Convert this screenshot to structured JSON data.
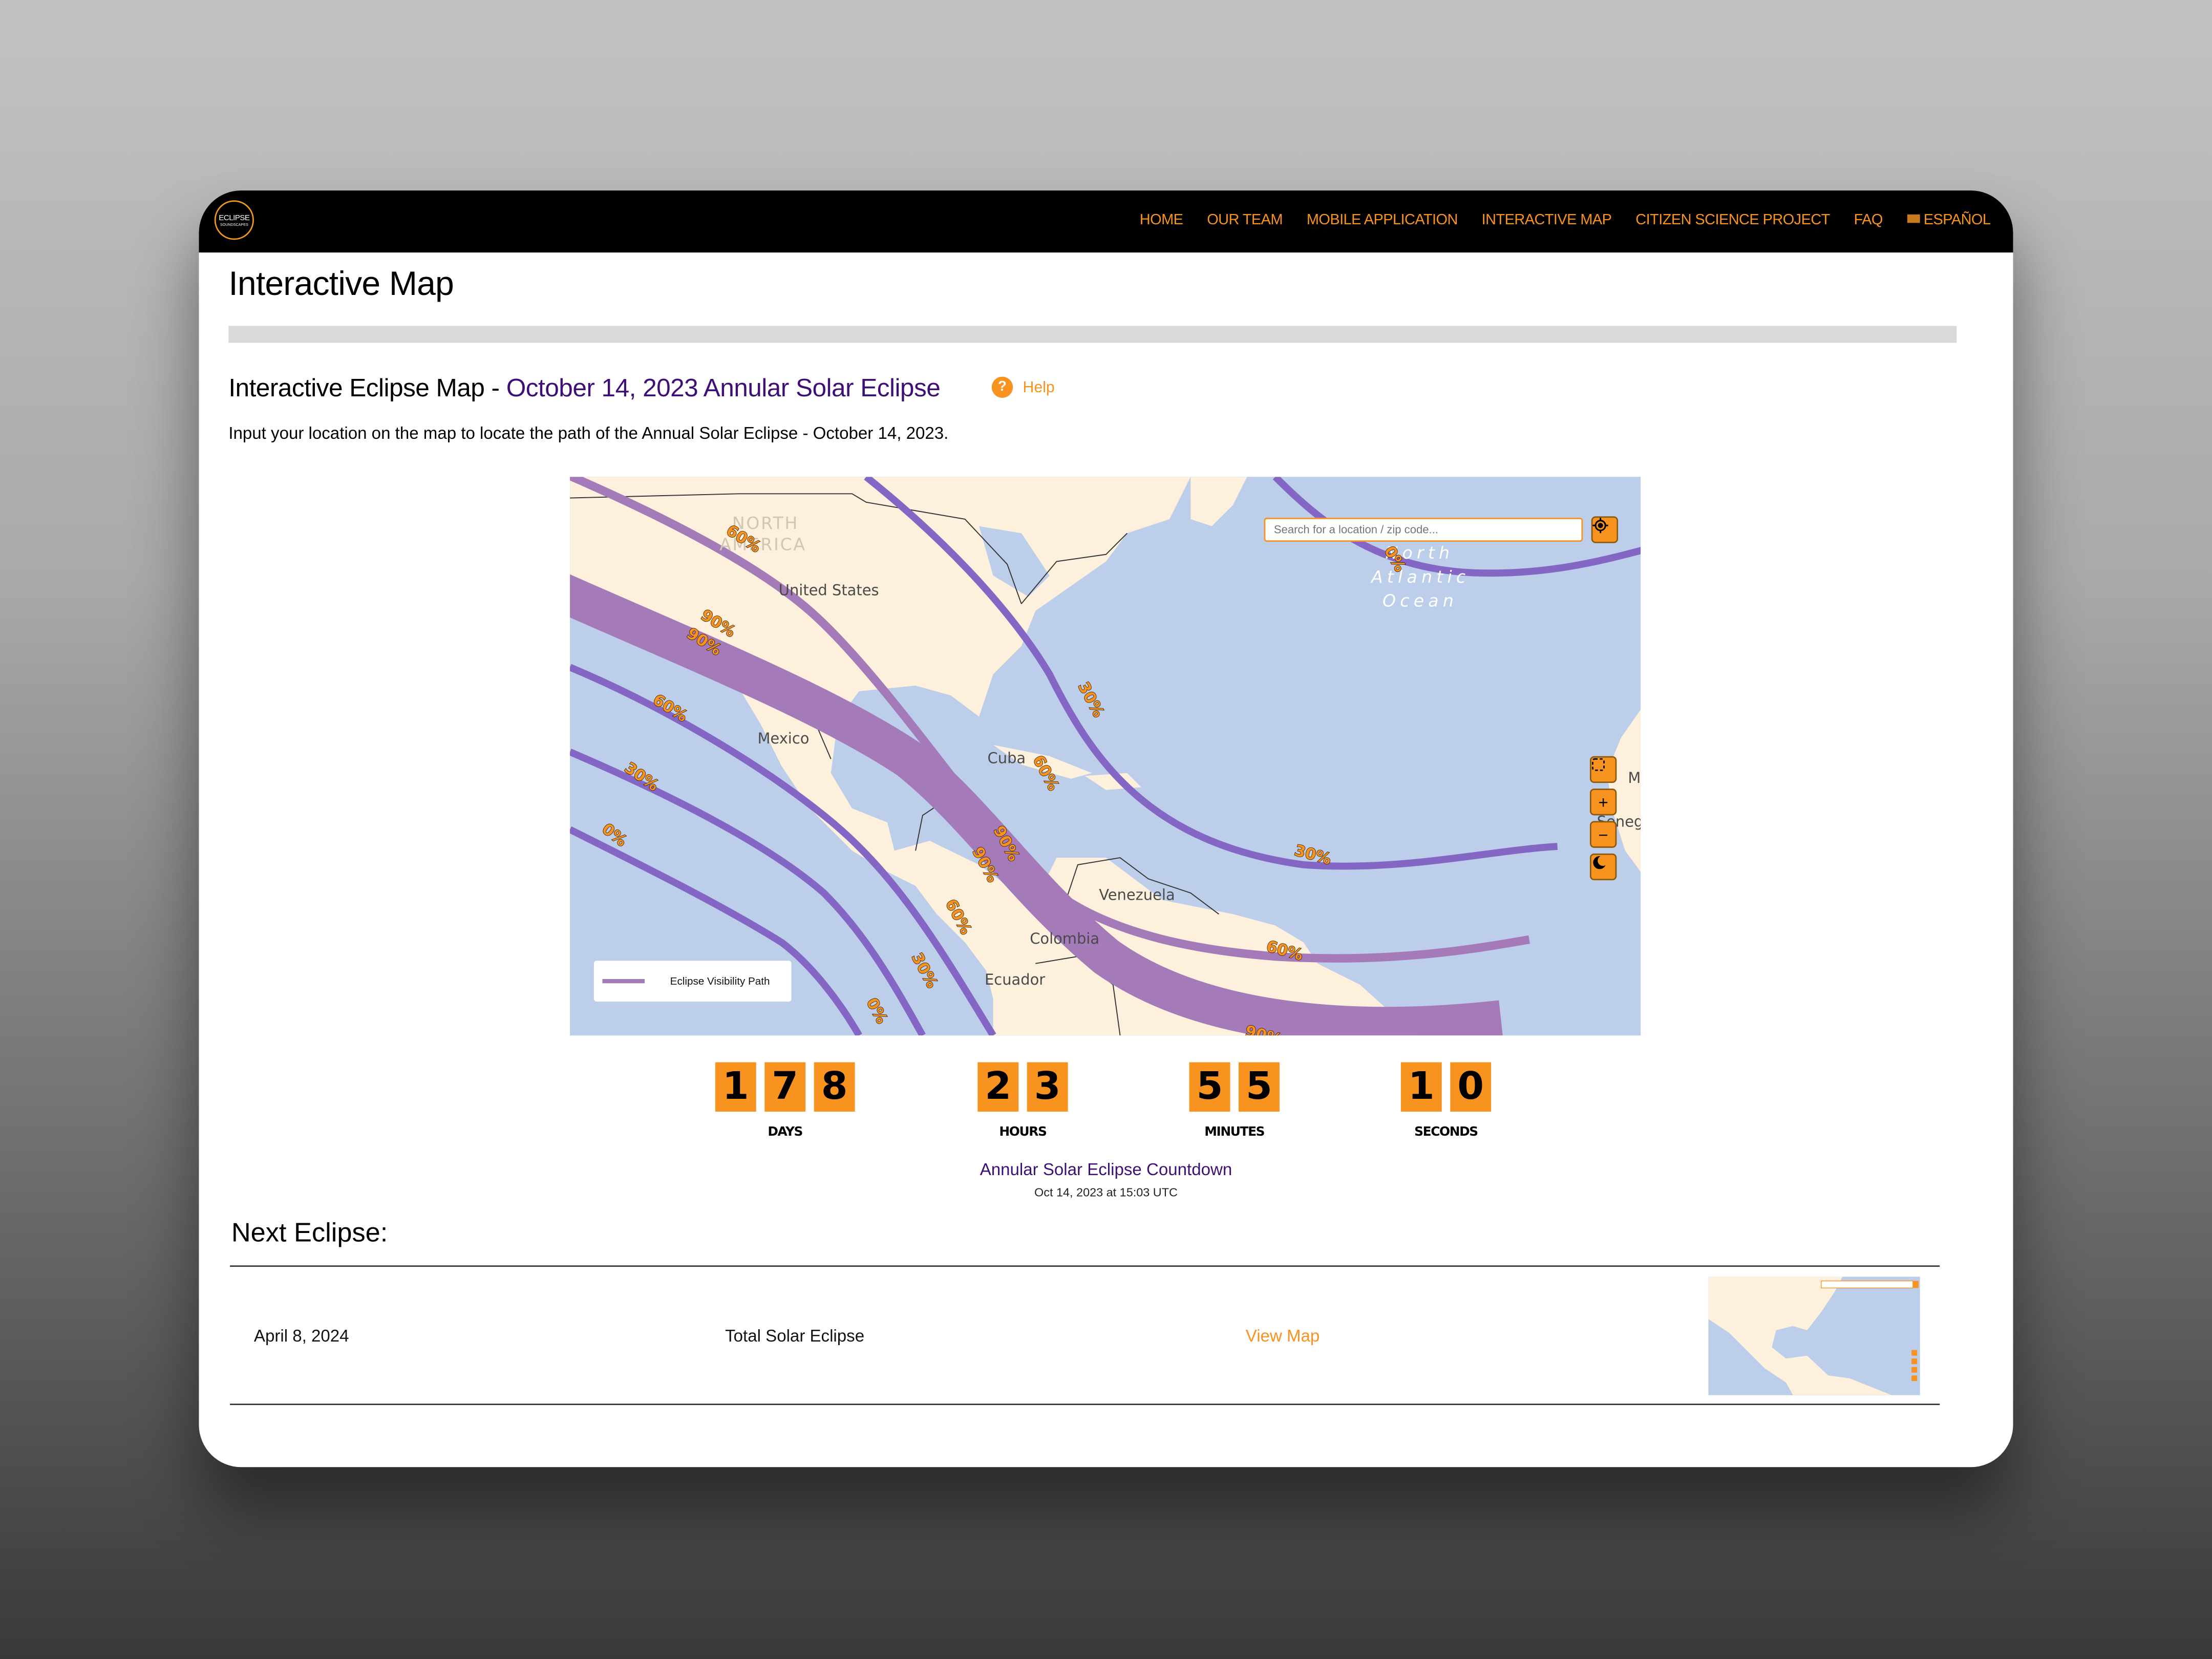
{
  "logo": {
    "line1": "ECLIPSE",
    "line2": "SOUNDSCAPES"
  },
  "nav": {
    "items": [
      "HOME",
      "OUR TEAM",
      "MOBILE APPLICATION",
      "INTERACTIVE MAP",
      "CITIZEN SCIENCE PROJECT",
      "FAQ",
      "ESPAÑOL"
    ]
  },
  "page": {
    "title": "Interactive Map",
    "subheading_prefix": "Interactive Eclipse Map - ",
    "subheading_highlight": "October 14, 2023 Annular Solar Eclipse",
    "help_icon": "?",
    "help_label": "Help",
    "intro": "Input your location on the map to locate the path of the Annual Solar Eclipse - October 14, 2023."
  },
  "map": {
    "search_placeholder": "Search for a location / zip code...",
    "locate_icon": "crosshair-icon",
    "controls": [
      "fullscreen-icon",
      "zoom-in-icon",
      "zoom-out-icon",
      "dark-mode-icon"
    ],
    "zoom_in_label": "+",
    "zoom_out_label": "−",
    "legend_label": "Eclipse Visibility Path",
    "region_labels": [
      "NORTH",
      "AMERICA"
    ],
    "ocean_labels": [
      "North",
      "Atlantic",
      "Ocean"
    ],
    "country_labels": [
      "United States",
      "Mexico",
      "Cuba",
      "Venezuela",
      "Colombia",
      "Ecuador",
      "M",
      "Seneg"
    ],
    "contour_labels": [
      "0%",
      "30%",
      "60%",
      "90%"
    ],
    "colors": {
      "land": "#fdf0dc",
      "water": "#bccee9",
      "path_land": "#a47ab8",
      "path_water": "#8466c4",
      "label": "#f7931e"
    }
  },
  "countdown": {
    "days": [
      "1",
      "7",
      "8"
    ],
    "hours": [
      "2",
      "3"
    ],
    "minutes": [
      "5",
      "5"
    ],
    "seconds": [
      "1",
      "0"
    ],
    "labels": {
      "days": "DAYS",
      "hours": "HOURS",
      "minutes": "MINUTES",
      "seconds": "SECONDS"
    },
    "title": "Annular Solar Eclipse Countdown",
    "date": "Oct 14, 2023 at 15:03 UTC"
  },
  "next_eclipse": {
    "heading": "Next Eclipse:",
    "rows": [
      {
        "date": "April 8, 2024",
        "type": "Total Solar Eclipse",
        "link": "View Map"
      }
    ]
  },
  "colors": {
    "accent": "#f7931e",
    "purple": "#3e1077",
    "nav_bg": "#000000"
  }
}
